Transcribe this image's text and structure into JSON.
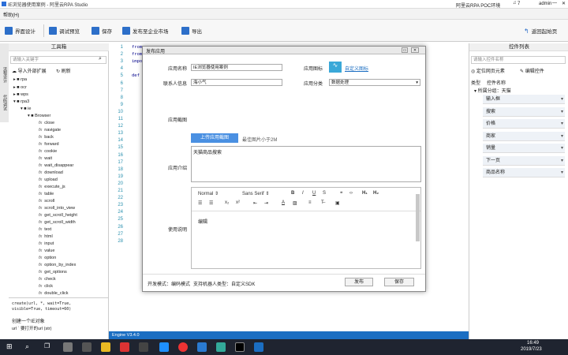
{
  "window": {
    "title": "IE浏览器使用案例 - 阿里云RPA Studio",
    "env": "阿里云RPA POC环境",
    "notif_count": "7",
    "user": "admin"
  },
  "menubar": {
    "help": "帮助(H)"
  },
  "toolbar": {
    "design": "界面设计",
    "debug": "调试预览",
    "save": "保存",
    "publish": "发布至企业市场",
    "export": "导出",
    "back": "返回起始页"
  },
  "left": {
    "tabs": [
      "流程设计",
      "代码调试"
    ],
    "title": "工具箱",
    "search_placeholder": "请输入关键字",
    "import": "导入外部扩展",
    "refresh": "刷新",
    "tree": [
      "rpa",
      "ocr",
      "wps",
      "rpa3",
      "ie",
      "Browser"
    ],
    "functions": [
      "close",
      "navigate",
      "back",
      "forward",
      "cookie",
      "wait",
      "wait_disappear",
      "download",
      "upload",
      "execute_js",
      "table",
      "scroll",
      "scroll_into_view",
      "get_scroll_height",
      "get_scroll_width",
      "text",
      "html",
      "input",
      "value",
      "option",
      "option_by_index",
      "get_options",
      "check",
      "click",
      "double_click"
    ],
    "doc_sig": "create(url, *, wait=True, visible=True, timeout=60)",
    "doc_desc": "创建一个IE对象",
    "doc_param": "url ` 要打开的url (str)"
  },
  "editor": {
    "line_numbers": [
      "1",
      "2",
      "3",
      "4",
      "5",
      "6",
      "7",
      "8",
      "9",
      "10",
      "11",
      "12",
      "13",
      "14",
      "15",
      "16",
      "17",
      "18",
      "19",
      "20",
      "21",
      "22",
      "23",
      "24",
      "25",
      "26",
      "27",
      "28"
    ],
    "code": [
      "from",
      "from",
      "impo",
      "",
      "def"
    ]
  },
  "dialog": {
    "title": "发布应用",
    "app_name_label": "应用名称",
    "app_name_value": "IE浏览器使用案例",
    "app_icon_label": "应用图标",
    "icon_link": "自定义图标",
    "contact_label": "联系人信息",
    "contact_value": "海小气",
    "category_label": "应用分类",
    "category_value": "数据处理",
    "screenshot_label": "应用截图",
    "upload_btn": "上传应用截图",
    "upload_hint": "最佳图片小于2M",
    "intro_label": "应用介绍",
    "intro_value": "天猫商品搜索",
    "usage_label": "使用说明",
    "editor_format": "Normal",
    "editor_font": "Sans Serif",
    "usage_value": "编辑",
    "footer_mode": "开发模式：编码模式",
    "footer_types": "支持机器人类型：自定义SDK",
    "publish_btn": "发布",
    "save_btn": "保存"
  },
  "right": {
    "title": "控件列表",
    "search_placeholder": "请输入控件名称",
    "locate": "定位网页元素",
    "edit": "编辑控件",
    "col_type": "类型",
    "col_name": "控件名称",
    "group": "▾ 所属分组：天猫",
    "controls": [
      "输入框",
      "搜索",
      "价格",
      "商家",
      "销量",
      "下一页",
      "商品名称"
    ]
  },
  "status": {
    "engine": "Engine V3.4.0"
  },
  "taskbar": {
    "time": "16:49",
    "date": "2019/7/23"
  },
  "colors": {
    "accent": "#1b6ec2",
    "taskbar": "#1f2430"
  }
}
